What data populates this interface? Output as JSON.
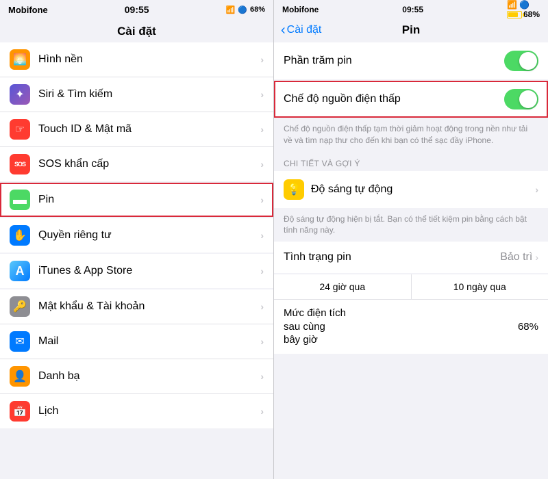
{
  "left": {
    "status": {
      "carrier": "Mobifone",
      "time": "09:55",
      "battery": "68%"
    },
    "title": "Cài đặt",
    "items": [
      {
        "id": "hinh-nen",
        "label": "Hình nền",
        "icon_bg": "#ff9500",
        "icon": "🌅",
        "highlighted": false
      },
      {
        "id": "siri",
        "label": "Siri & Tìm kiếm",
        "icon_bg": "#5856d6",
        "icon": "✦",
        "highlighted": false
      },
      {
        "id": "touch-id",
        "label": "Touch ID & Mật mã",
        "icon_bg": "#ff3b30",
        "icon": "☞",
        "highlighted": false
      },
      {
        "id": "sos",
        "label": "SOS khẩn cấp",
        "icon_bg": "#ff3b30",
        "icon": "SOS",
        "highlighted": false
      },
      {
        "id": "pin",
        "label": "Pin",
        "icon_bg": "#4cd964",
        "icon": "▬",
        "highlighted": true
      },
      {
        "id": "quyen-rieng-tu",
        "label": "Quyền riêng tư",
        "icon_bg": "#007aff",
        "icon": "✋",
        "highlighted": false
      },
      {
        "id": "itunes",
        "label": "iTunes & App Store",
        "icon_bg": "#5af",
        "icon": "A",
        "highlighted": false
      },
      {
        "id": "mat-khau",
        "label": "Mật khẩu & Tài khoản",
        "icon_bg": "#8e8e93",
        "icon": "🔑",
        "highlighted": false
      },
      {
        "id": "mail",
        "label": "Mail",
        "icon_bg": "#007aff",
        "icon": "✉",
        "highlighted": false
      },
      {
        "id": "danh-ba",
        "label": "Danh bạ",
        "icon_bg": "#ff9500",
        "icon": "👤",
        "highlighted": false
      },
      {
        "id": "lich",
        "label": "Lịch",
        "icon_bg": "#ff3b30",
        "icon": "📅",
        "highlighted": false
      }
    ]
  },
  "right": {
    "status": {
      "carrier": "Mobifone",
      "time": "09:55",
      "battery": "68%"
    },
    "back_label": "Cài đặt",
    "title": "Pin",
    "sections": {
      "phan_tram_pin": {
        "label": "Phần trăm pin",
        "toggle_on": true
      },
      "che_do_nguon": {
        "label": "Chế độ nguồn điện thấp",
        "toggle_on": true,
        "highlighted": true,
        "description": "Chế độ nguồn điện thấp tạm thời giảm hoạt động trong nền như tải về và tìm nạp thư cho đến khi bạn có thể sạc đầy iPhone."
      },
      "section_header": "CHI TIẾT VÀ GỢI Ý",
      "do_sang": {
        "label": "Độ sáng tự động",
        "description": "Độ sáng tự động hiện bị tắt. Bạn có thể tiết kiệm pin bằng cách bật tính năng này."
      },
      "tinh_trang": {
        "label": "Tình trạng pin",
        "value": "Bảo trì"
      },
      "tabs": {
        "tab1": "24 giờ qua",
        "tab2": "10 ngày qua"
      },
      "muc_dien_tich": {
        "label_line1": "Mức điện tích",
        "label_line2": "sau cùng",
        "label_line3": "bây giờ",
        "value": "68%"
      }
    }
  }
}
